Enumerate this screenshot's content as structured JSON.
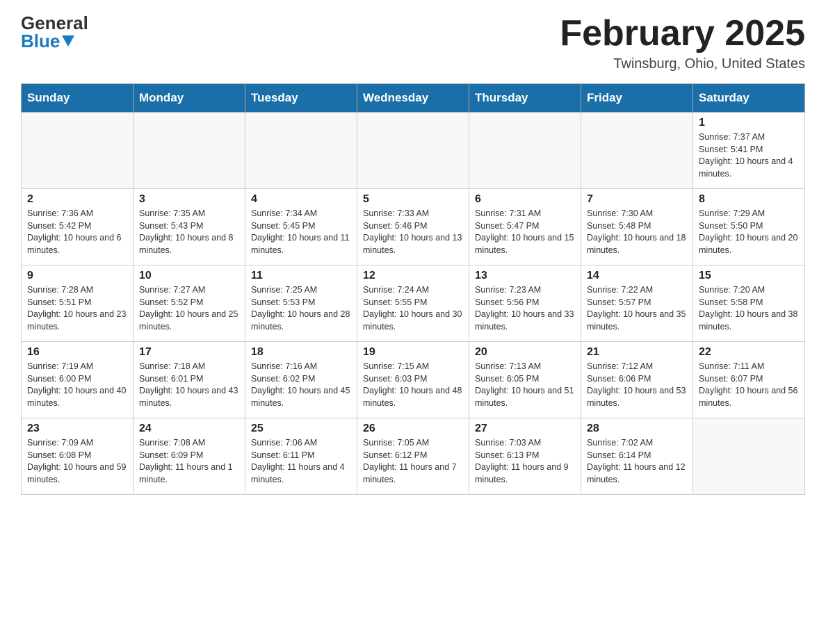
{
  "header": {
    "logo": {
      "general": "General",
      "blue": "Blue",
      "triangle": "▲"
    },
    "title": "February 2025",
    "location": "Twinsburg, Ohio, United States"
  },
  "days_of_week": [
    "Sunday",
    "Monday",
    "Tuesday",
    "Wednesday",
    "Thursday",
    "Friday",
    "Saturday"
  ],
  "weeks": [
    [
      {
        "day": "",
        "info": ""
      },
      {
        "day": "",
        "info": ""
      },
      {
        "day": "",
        "info": ""
      },
      {
        "day": "",
        "info": ""
      },
      {
        "day": "",
        "info": ""
      },
      {
        "day": "",
        "info": ""
      },
      {
        "day": "1",
        "info": "Sunrise: 7:37 AM\nSunset: 5:41 PM\nDaylight: 10 hours and 4 minutes."
      }
    ],
    [
      {
        "day": "2",
        "info": "Sunrise: 7:36 AM\nSunset: 5:42 PM\nDaylight: 10 hours and 6 minutes."
      },
      {
        "day": "3",
        "info": "Sunrise: 7:35 AM\nSunset: 5:43 PM\nDaylight: 10 hours and 8 minutes."
      },
      {
        "day": "4",
        "info": "Sunrise: 7:34 AM\nSunset: 5:45 PM\nDaylight: 10 hours and 11 minutes."
      },
      {
        "day": "5",
        "info": "Sunrise: 7:33 AM\nSunset: 5:46 PM\nDaylight: 10 hours and 13 minutes."
      },
      {
        "day": "6",
        "info": "Sunrise: 7:31 AM\nSunset: 5:47 PM\nDaylight: 10 hours and 15 minutes."
      },
      {
        "day": "7",
        "info": "Sunrise: 7:30 AM\nSunset: 5:48 PM\nDaylight: 10 hours and 18 minutes."
      },
      {
        "day": "8",
        "info": "Sunrise: 7:29 AM\nSunset: 5:50 PM\nDaylight: 10 hours and 20 minutes."
      }
    ],
    [
      {
        "day": "9",
        "info": "Sunrise: 7:28 AM\nSunset: 5:51 PM\nDaylight: 10 hours and 23 minutes."
      },
      {
        "day": "10",
        "info": "Sunrise: 7:27 AM\nSunset: 5:52 PM\nDaylight: 10 hours and 25 minutes."
      },
      {
        "day": "11",
        "info": "Sunrise: 7:25 AM\nSunset: 5:53 PM\nDaylight: 10 hours and 28 minutes."
      },
      {
        "day": "12",
        "info": "Sunrise: 7:24 AM\nSunset: 5:55 PM\nDaylight: 10 hours and 30 minutes."
      },
      {
        "day": "13",
        "info": "Sunrise: 7:23 AM\nSunset: 5:56 PM\nDaylight: 10 hours and 33 minutes."
      },
      {
        "day": "14",
        "info": "Sunrise: 7:22 AM\nSunset: 5:57 PM\nDaylight: 10 hours and 35 minutes."
      },
      {
        "day": "15",
        "info": "Sunrise: 7:20 AM\nSunset: 5:58 PM\nDaylight: 10 hours and 38 minutes."
      }
    ],
    [
      {
        "day": "16",
        "info": "Sunrise: 7:19 AM\nSunset: 6:00 PM\nDaylight: 10 hours and 40 minutes."
      },
      {
        "day": "17",
        "info": "Sunrise: 7:18 AM\nSunset: 6:01 PM\nDaylight: 10 hours and 43 minutes."
      },
      {
        "day": "18",
        "info": "Sunrise: 7:16 AM\nSunset: 6:02 PM\nDaylight: 10 hours and 45 minutes."
      },
      {
        "day": "19",
        "info": "Sunrise: 7:15 AM\nSunset: 6:03 PM\nDaylight: 10 hours and 48 minutes."
      },
      {
        "day": "20",
        "info": "Sunrise: 7:13 AM\nSunset: 6:05 PM\nDaylight: 10 hours and 51 minutes."
      },
      {
        "day": "21",
        "info": "Sunrise: 7:12 AM\nSunset: 6:06 PM\nDaylight: 10 hours and 53 minutes."
      },
      {
        "day": "22",
        "info": "Sunrise: 7:11 AM\nSunset: 6:07 PM\nDaylight: 10 hours and 56 minutes."
      }
    ],
    [
      {
        "day": "23",
        "info": "Sunrise: 7:09 AM\nSunset: 6:08 PM\nDaylight: 10 hours and 59 minutes."
      },
      {
        "day": "24",
        "info": "Sunrise: 7:08 AM\nSunset: 6:09 PM\nDaylight: 11 hours and 1 minute."
      },
      {
        "day": "25",
        "info": "Sunrise: 7:06 AM\nSunset: 6:11 PM\nDaylight: 11 hours and 4 minutes."
      },
      {
        "day": "26",
        "info": "Sunrise: 7:05 AM\nSunset: 6:12 PM\nDaylight: 11 hours and 7 minutes."
      },
      {
        "day": "27",
        "info": "Sunrise: 7:03 AM\nSunset: 6:13 PM\nDaylight: 11 hours and 9 minutes."
      },
      {
        "day": "28",
        "info": "Sunrise: 7:02 AM\nSunset: 6:14 PM\nDaylight: 11 hours and 12 minutes."
      },
      {
        "day": "",
        "info": ""
      }
    ]
  ]
}
